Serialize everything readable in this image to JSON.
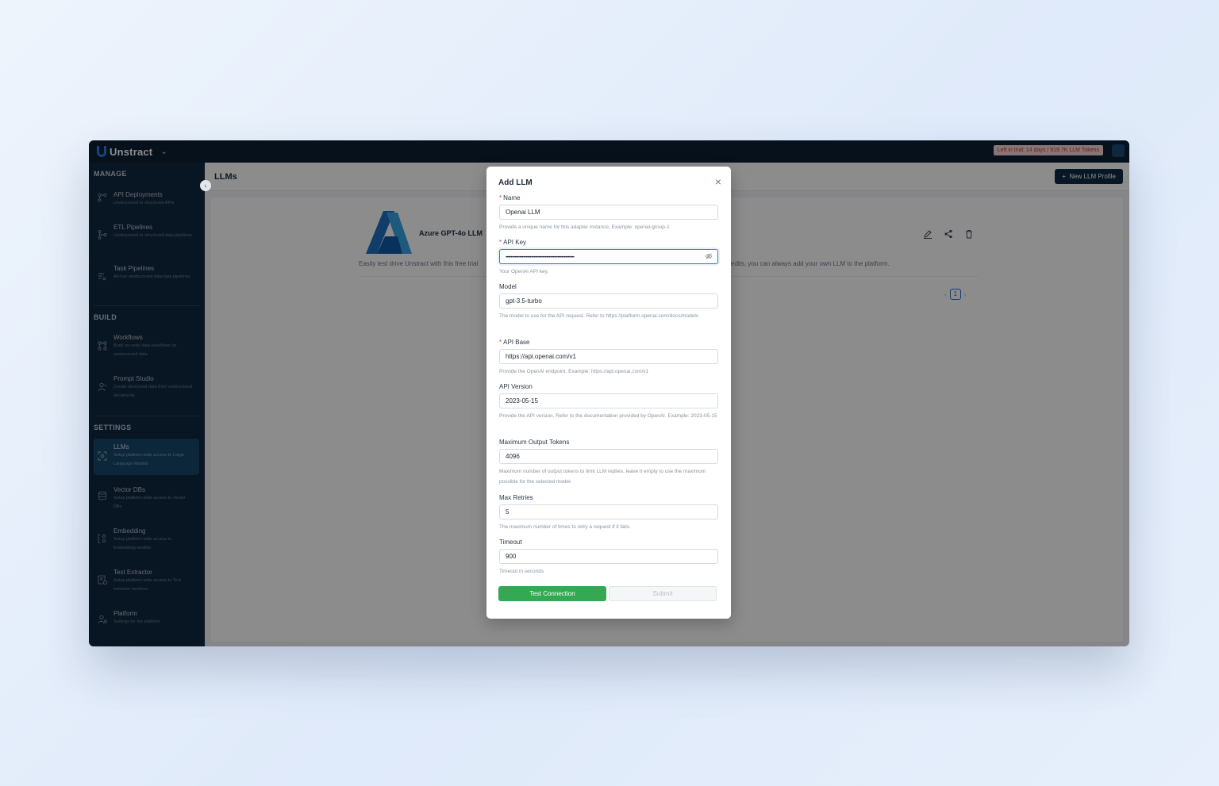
{
  "topbar": {
    "brand": "Unstract",
    "trial_badge": "Left in trial: 14 days / 919.7K LLM Tokens"
  },
  "sidebar": {
    "manage_title": "MANAGE",
    "manage_items": [
      {
        "label": "API Deployments",
        "desc": "Unstructured to structured APIs",
        "icon": "api-deployments-icon"
      },
      {
        "label": "ETL Pipelines",
        "desc": "Unstructured to structured data pipelines",
        "icon": "etl-pipelines-icon"
      },
      {
        "label": "Task Pipelines",
        "desc": "Ad-hoc unstructured data task pipelines",
        "icon": "task-pipelines-icon"
      }
    ],
    "build_title": "BUILD",
    "build_items": [
      {
        "label": "Workflows",
        "desc": "Build no-code data workflows for unstructured data",
        "icon": "workflows-icon"
      },
      {
        "label": "Prompt Studio",
        "desc": "Create structured data from unstructured documents",
        "icon": "prompt-studio-icon"
      }
    ],
    "settings_title": "SETTINGS",
    "settings_items": [
      {
        "label": "LLMs",
        "desc": "Setup platform wide access to Large Language Models",
        "icon": "llms-icon",
        "active": true
      },
      {
        "label": "Vector DBs",
        "desc": "Setup platform wide access to Vector DBs",
        "icon": "vector-dbs-icon"
      },
      {
        "label": "Embedding",
        "desc": "Setup platform wide access to Embedding models",
        "icon": "embedding-icon"
      },
      {
        "label": "Text Extractor",
        "desc": "Setup platform wide access to Text extractor services",
        "icon": "text-extractor-icon"
      },
      {
        "label": "Platform",
        "desc": "Settings for the platform",
        "icon": "platform-icon"
      }
    ]
  },
  "main": {
    "title": "LLMs",
    "new_button": "New LLM Profile",
    "llm_card": {
      "name": "Azure GPT-4o LLM",
      "desc_left": "Easily test drive Unstract with this free trial",
      "desc_right": "edits, you can always add your own LLM to the platform."
    },
    "pagination": {
      "current": "1"
    }
  },
  "modal": {
    "title": "Add LLM",
    "fields": {
      "name": {
        "label": "Name",
        "required": true,
        "value": "Openai LLM",
        "help": "Provide a unique name for this adapter instance. Example: openai-group-1"
      },
      "api_key": {
        "label": "API Key",
        "required": true,
        "value": "••••••••••••••••••••••••••••••••••••••••••••••••••••••",
        "help": "Your OpenAI API key."
      },
      "model": {
        "label": "Model",
        "required": false,
        "value": "gpt-3.5-turbo",
        "help": "The model to use for the API request. Refer to https://platform.openai.com/docs/models"
      },
      "api_base": {
        "label": "API Base",
        "required": true,
        "value": "https://api.openai.com/v1",
        "help": "Provide the OpenAI endpoint. Example: https://api.openai.com/v1"
      },
      "api_version": {
        "label": "API Version",
        "required": false,
        "value": "2023-05-15",
        "help": "Provide the API version. Refer to the documentation provided by OpenAI. Example: 2023-05-15"
      },
      "max_output_tokens": {
        "label": "Maximum Output Tokens",
        "required": false,
        "value": "4096",
        "help": "Maximum number of output tokens to limit LLM replies, leave it empty to use the maximum possible for the selected model."
      },
      "max_retries": {
        "label": "Max Retries",
        "required": false,
        "value": "5",
        "help": "The maximum number of times to retry a request if it fails."
      },
      "timeout": {
        "label": "Timeout",
        "required": false,
        "value": "900",
        "help": "Timeout in seconds"
      }
    },
    "test_button": "Test Connection",
    "submit_button": "Submit"
  },
  "colors": {
    "topbar": "#0b1f33",
    "sidebar": "#0f2740",
    "sidebar_active": "#17466a",
    "primary_button": "#0d2a45",
    "test_button": "#34a853",
    "focus_border": "#2f7de1",
    "required_marker": "#e53935"
  }
}
